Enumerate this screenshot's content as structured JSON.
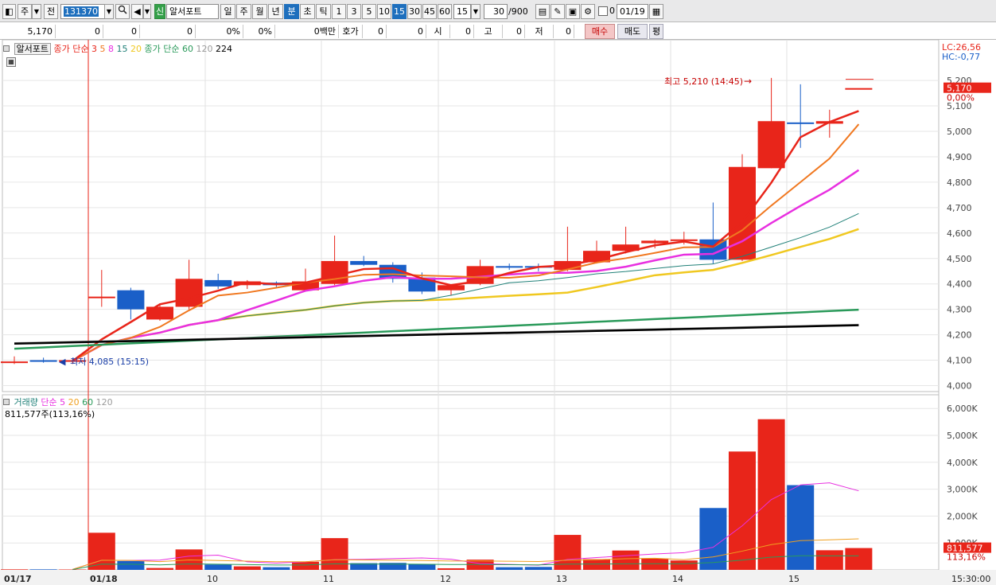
{
  "toolbar": {
    "btn_ju": "주",
    "btn_jeon": "전",
    "code": "131370",
    "name": "알서포트",
    "name_badge": "신",
    "periods": [
      "일",
      "주",
      "월",
      "년",
      "분",
      "초",
      "틱"
    ],
    "selected_period": "분",
    "intervals": [
      "1",
      "3",
      "5",
      "10",
      "15",
      "30",
      "45",
      "60"
    ],
    "selected_interval": "15",
    "interval_value": "15",
    "count": "30",
    "count_total": "/900",
    "date_value": "01/19",
    "checkbox_label": "0"
  },
  "info": {
    "price": "5,170",
    "change": "0",
    "change_pct": "0",
    "volume": "0",
    "vol_pct": "0%",
    "amt_pct": "0%",
    "amount": "0백만",
    "hoga_label": "호가",
    "hoga_v1": "0",
    "hoga_v2": "0",
    "open_label": "시",
    "open_v": "0",
    "high_label": "고",
    "high_v": "0",
    "low_label": "저",
    "low_v": "0",
    "buy": "매수",
    "sell": "매도",
    "eval": "평"
  },
  "legend_price": {
    "name": "알서포트",
    "ma_label": "종가 단순",
    "ma_periods": [
      "3",
      "5",
      "8",
      "15",
      "20"
    ],
    "ma2_label": "종가 단순",
    "ma2_periods": [
      "60",
      "120",
      "224"
    ]
  },
  "legend_volume": {
    "name": "거래량",
    "ma_label": "단순",
    "ma_periods": [
      "5",
      "20",
      "60",
      "120"
    ],
    "current": "811,577주(113,16%)"
  },
  "right_info": {
    "lc": "LC:26,56",
    "hc": "HC:-0,77"
  },
  "annotations": {
    "high": "최고 5,210 (14:45)",
    "low": "최저 4,085 (15:15)",
    "price_tag": "5,170",
    "price_pct": "0,00%",
    "vol_tag": "811,577",
    "vol_pct": "113,16%",
    "time_tag": "15:30:00"
  },
  "colors": {
    "up": "#e8251a",
    "down": "#1a5fc8",
    "ma3": "#e8251a",
    "ma5": "#f07820",
    "ma8": "#e830e0",
    "ma15": "#208078",
    "ma20": "#f0c820",
    "ma60": "#2a9a5a",
    "ma120": "#9a9a9a",
    "ma224": "#000000"
  },
  "chart_data": {
    "type": "candlestick",
    "price_ticks": [
      "5,200",
      "5,100",
      "5,000",
      "4,900",
      "4,800",
      "4,700",
      "4,600",
      "4,500",
      "4,400",
      "4,300",
      "4,200",
      "4,100",
      "4,000"
    ],
    "volume_ticks": [
      "6,000K",
      "5,000K",
      "4,000K",
      "3,000K",
      "2,000K",
      "1,000K"
    ],
    "x_labels": [
      "01/17",
      "01/18",
      "10",
      "11",
      "12",
      "13",
      "14",
      "15"
    ],
    "candles": [
      {
        "o": 4095,
        "h": 4115,
        "l": 4085,
        "c": 4095,
        "v": 20000
      },
      {
        "o": 4100,
        "h": 4110,
        "l": 4090,
        "c": 4095,
        "v": 20000
      },
      {
        "o": 4095,
        "h": 4105,
        "l": 4085,
        "c": 4100,
        "v": 15000
      },
      {
        "o": 4350,
        "h": 4455,
        "l": 4310,
        "c": 4350,
        "v": 1380000
      },
      {
        "o": 4375,
        "h": 4385,
        "l": 4260,
        "c": 4300,
        "v": 330000
      },
      {
        "o": 4260,
        "h": 4320,
        "l": 4255,
        "c": 4310,
        "v": 70000
      },
      {
        "o": 4310,
        "h": 4495,
        "l": 4300,
        "c": 4420,
        "v": 760000
      },
      {
        "o": 4415,
        "h": 4440,
        "l": 4380,
        "c": 4390,
        "v": 200000
      },
      {
        "o": 4395,
        "h": 4415,
        "l": 4380,
        "c": 4410,
        "v": 130000
      },
      {
        "o": 4405,
        "h": 4410,
        "l": 4385,
        "c": 4395,
        "v": 100000
      },
      {
        "o": 4375,
        "h": 4460,
        "l": 4370,
        "c": 4410,
        "v": 300000
      },
      {
        "o": 4400,
        "h": 4590,
        "l": 4395,
        "c": 4490,
        "v": 1180000
      },
      {
        "o": 4490,
        "h": 4510,
        "l": 4470,
        "c": 4475,
        "v": 250000
      },
      {
        "o": 4475,
        "h": 4485,
        "l": 4405,
        "c": 4420,
        "v": 260000
      },
      {
        "o": 4425,
        "h": 4445,
        "l": 4360,
        "c": 4370,
        "v": 220000
      },
      {
        "o": 4375,
        "h": 4390,
        "l": 4355,
        "c": 4395,
        "v": 60000
      },
      {
        "o": 4400,
        "h": 4495,
        "l": 4395,
        "c": 4470,
        "v": 380000
      },
      {
        "o": 4470,
        "h": 4480,
        "l": 4455,
        "c": 4465,
        "v": 100000
      },
      {
        "o": 4470,
        "h": 4480,
        "l": 4450,
        "c": 4465,
        "v": 110000
      },
      {
        "o": 4455,
        "h": 4625,
        "l": 4450,
        "c": 4490,
        "v": 1300000
      },
      {
        "o": 4485,
        "h": 4570,
        "l": 4480,
        "c": 4530,
        "v": 400000
      },
      {
        "o": 4530,
        "h": 4625,
        "l": 4520,
        "c": 4555,
        "v": 720000
      },
      {
        "o": 4560,
        "h": 4575,
        "l": 4540,
        "c": 4570,
        "v": 420000
      },
      {
        "o": 4570,
        "h": 4605,
        "l": 4555,
        "c": 4575,
        "v": 350000
      },
      {
        "o": 4575,
        "h": 4720,
        "l": 4480,
        "c": 4495,
        "v": 2300000
      },
      {
        "o": 4495,
        "h": 4910,
        "l": 4490,
        "c": 4860,
        "v": 4400000
      },
      {
        "o": 4855,
        "h": 5210,
        "l": 4855,
        "c": 5040,
        "v": 5600000
      },
      {
        "o": 5035,
        "h": 5185,
        "l": 4935,
        "c": 5030,
        "v": 3150000
      },
      {
        "o": 5030,
        "h": 5085,
        "l": 4975,
        "c": 5040,
        "v": 730000
      },
      {
        "o": 5170,
        "h": 5170,
        "l": 5170,
        "c": 5170,
        "v": 811577
      }
    ]
  }
}
